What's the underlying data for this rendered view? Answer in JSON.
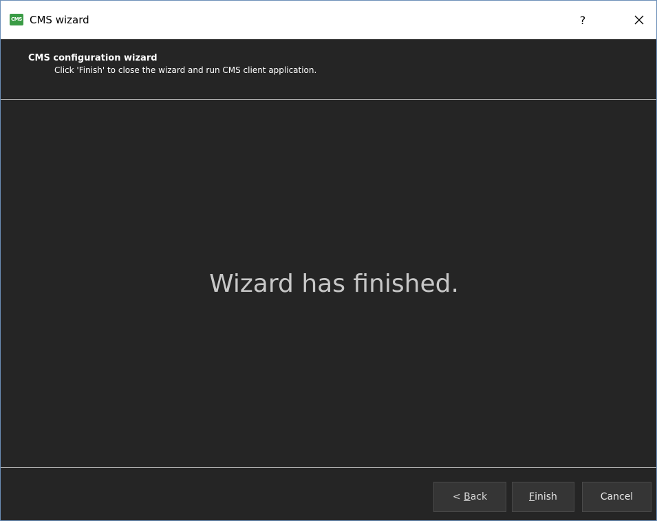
{
  "window": {
    "title": "CMS wizard",
    "help_label": "?",
    "icon_name": "cms-app-icon",
    "icon_text": "CMS",
    "close_icon_name": "close-icon"
  },
  "header": {
    "title": "CMS configuration wizard",
    "subtitle": "Click 'Finish' to close the wizard and run CMS client application."
  },
  "main": {
    "message": "Wizard has finished."
  },
  "footer": {
    "back": {
      "mnemonic": "B",
      "prefix": "< ",
      "rest": "ack"
    },
    "finish": {
      "mnemonic": "F",
      "rest": "inish"
    },
    "cancel": {
      "label": "Cancel"
    }
  },
  "colors": {
    "background": "#252525",
    "titlebar": "#ffffff",
    "button_bg": "#353535",
    "app_icon": "#3a9b45",
    "message_text": "#c8c8c8"
  }
}
